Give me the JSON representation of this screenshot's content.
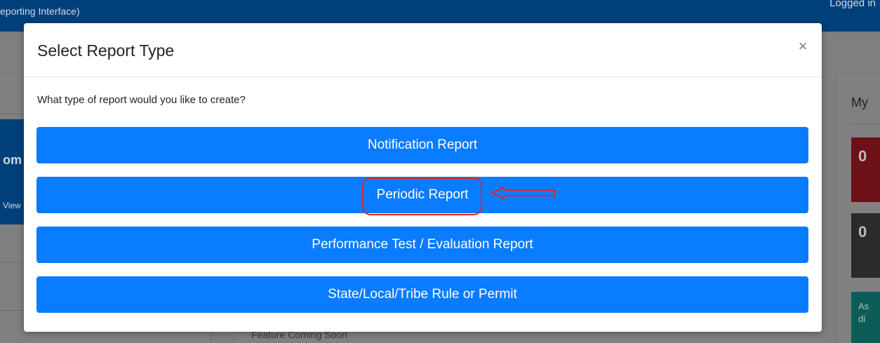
{
  "background": {
    "header_title": "eporting Interface)",
    "logged_text": "Logged in",
    "left_tile_text": "om",
    "left_tile_link": "View",
    "right_card_title": "My",
    "right_tiles": [
      "0",
      "0",
      "As\ndi"
    ],
    "feature_text": "Feature Coming Soon"
  },
  "modal": {
    "title": "Select Report Type",
    "close_icon": "close-icon",
    "close_glyph": "×",
    "prompt": "What type of report would you like to create?",
    "options": [
      "Notification Report",
      "Periodic Report",
      "Performance Test / Evaluation Report",
      "State/Local/Tribe Rule or Permit"
    ]
  },
  "annotation": {
    "highlight_color": "#e0262a",
    "target": "Periodic Report"
  },
  "colors": {
    "primary_button": "#0a7cff",
    "header_bar": "#00407a",
    "overlay_gray": "#7f7f7f"
  }
}
